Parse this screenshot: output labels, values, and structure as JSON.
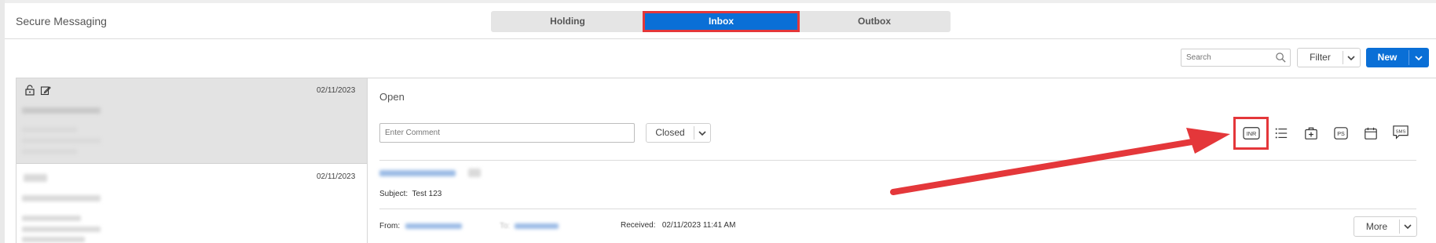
{
  "app": {
    "title": "Secure Messaging"
  },
  "tabs": [
    {
      "label": "Holding"
    },
    {
      "label": "Inbox"
    },
    {
      "label": "Outbox"
    }
  ],
  "toolbar": {
    "search_placeholder": "Search",
    "filter_label": "Filter",
    "new_label": "New"
  },
  "messages": [
    {
      "date": "02/11/2023"
    },
    {
      "date": "02/11/2023"
    }
  ],
  "detail": {
    "status": "Open",
    "comment_placeholder": "Enter Comment",
    "closed_label": "Closed",
    "subject_label": "Subject:",
    "subject_value": "Test 123",
    "from_label": "From:",
    "to_label": "To:",
    "received_label": "Received:",
    "received_value": "02/11/2023 11:41 AM",
    "more_label": "More"
  },
  "action_icons": [
    {
      "name": "inr-icon",
      "text": "INR"
    },
    {
      "name": "list-icon"
    },
    {
      "name": "medical-bag-icon"
    },
    {
      "name": "ps-icon",
      "text": "PS"
    },
    {
      "name": "calendar-icon"
    },
    {
      "name": "sms-icon",
      "text": "SMS"
    }
  ],
  "colors": {
    "accent": "#0a6fd6",
    "highlight": "#e4373a",
    "selected_row": "#e3e3e3"
  }
}
